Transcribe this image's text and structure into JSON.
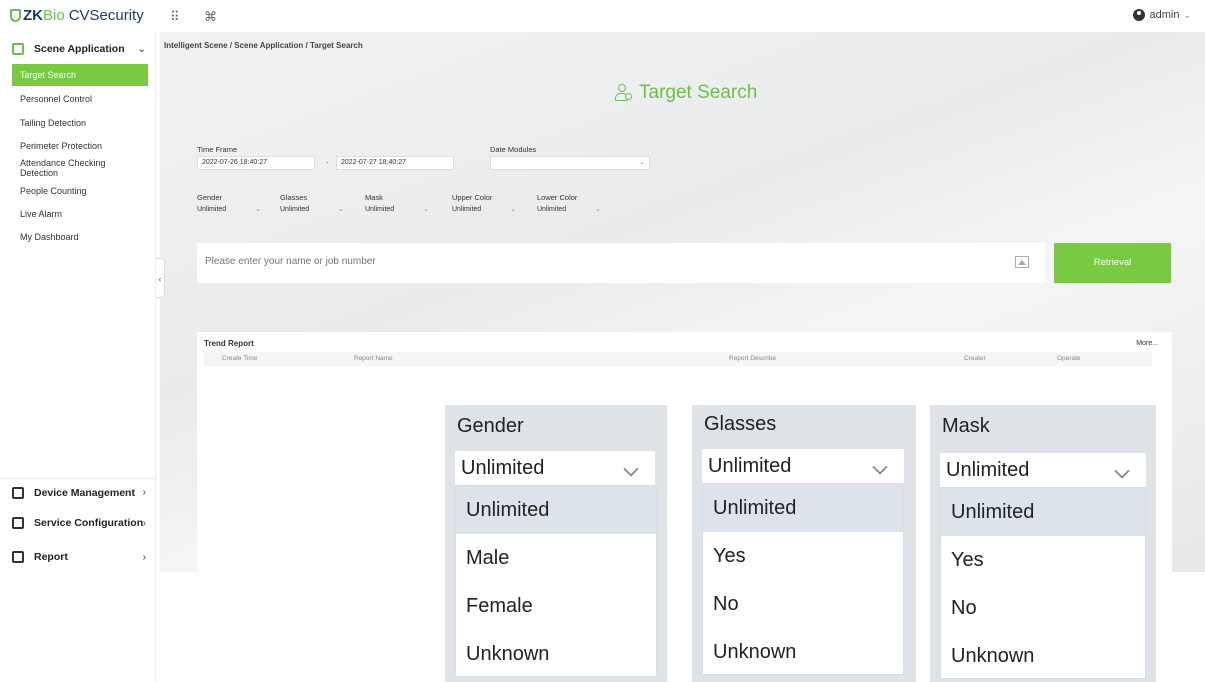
{
  "app": {
    "brand_zk": "ZK",
    "brand_bio": "Bio",
    "brand_product": "CVSecurity"
  },
  "topbar": {
    "grid_icon": "⠿",
    "cmd_icon": "⌘",
    "user": "admin"
  },
  "sidebar": {
    "scene_group": "Scene Application",
    "items": [
      {
        "label": "Target Search",
        "active": true
      },
      {
        "label": "Personnel Control"
      },
      {
        "label": "Tailing Detection"
      },
      {
        "label": "Perimeter Protection"
      },
      {
        "label": "Attendance Checking Detection"
      },
      {
        "label": "People Counting"
      },
      {
        "label": "Live Alarm"
      },
      {
        "label": "My Dashboard"
      }
    ],
    "device_group": "Device Management",
    "service_group": "Service Configuration",
    "report_group": "Report"
  },
  "main": {
    "breadcrumb": "Intelligent Scene / Scene Application / Target Search",
    "title": "Target Search",
    "time_frame_label": "Time Frame",
    "time_start": "2022-07-26 18:40:27",
    "time_end": "2022-07-27 18:40:27",
    "date_modules_label": "Date Modules",
    "date_modules_value": "",
    "filters": [
      {
        "label": "Gender",
        "value": "Unlimited"
      },
      {
        "label": "Glasses",
        "value": "Unlimited"
      },
      {
        "label": "Mask",
        "value": "Unlimited"
      },
      {
        "label": "Upper Color",
        "value": "Unlimited"
      },
      {
        "label": "Lower Color",
        "value": "Unlimited"
      }
    ],
    "search_placeholder": "Please enter your name or job number",
    "retrieval_label": "Retrieval",
    "trend": {
      "title": "Trend Report",
      "more": "More...",
      "columns": [
        "Create Time",
        "Report Name",
        "Report Describe",
        "Creater",
        "Operate"
      ]
    }
  },
  "callouts": [
    {
      "label": "Gender",
      "value": "Unlimited",
      "options": [
        "Unlimited",
        "Male",
        "Female",
        "Unknown"
      ]
    },
    {
      "label": "Glasses",
      "value": "Unlimited",
      "options": [
        "Unlimited",
        "Yes",
        "No",
        "Unknown"
      ]
    },
    {
      "label": "Mask",
      "value": "Unlimited",
      "options": [
        "Unlimited",
        "Yes",
        "No",
        "Unknown"
      ]
    }
  ],
  "colors": {
    "accent": "#7ac943",
    "brand_dark": "#1f3a68",
    "highlight": "#dde3ea"
  }
}
